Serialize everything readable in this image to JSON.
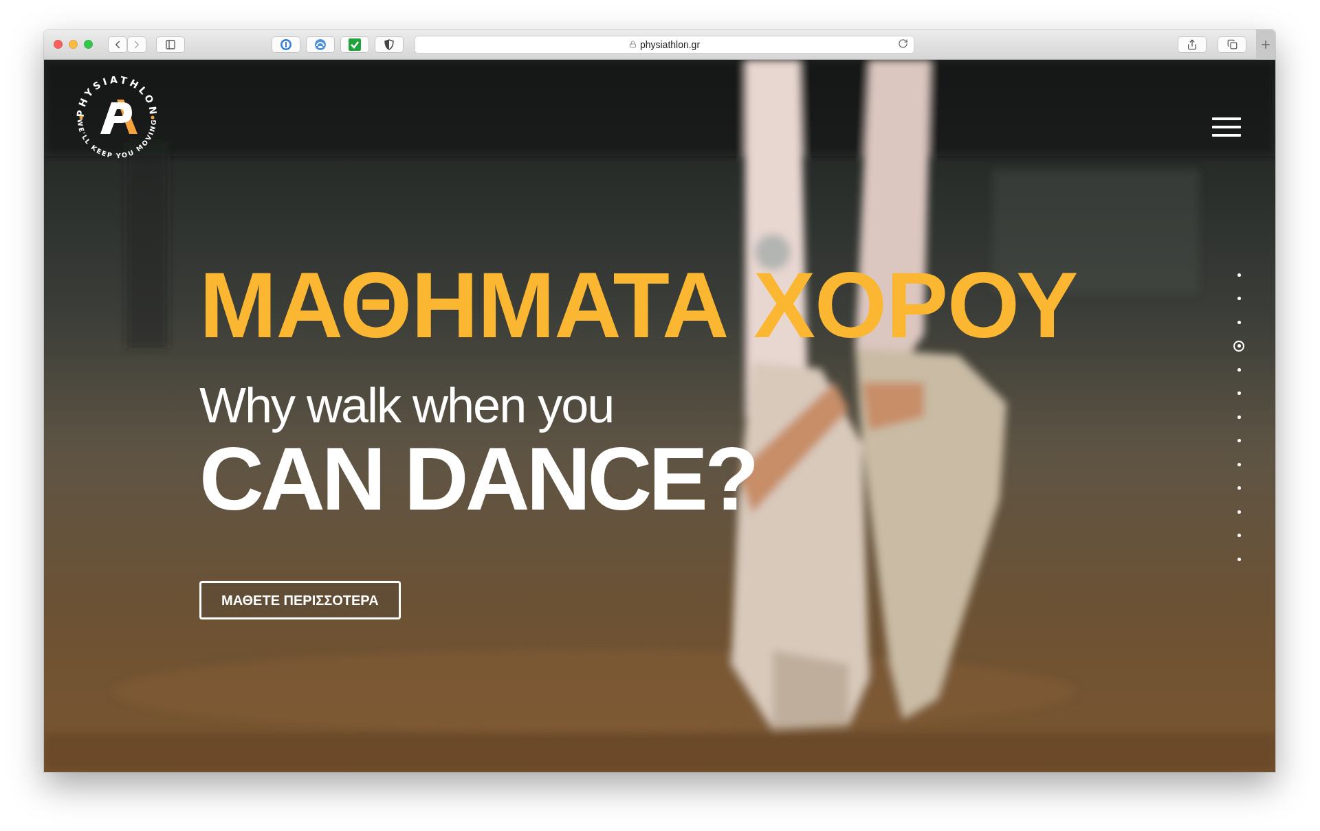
{
  "browser": {
    "url": "physiathlon.gr"
  },
  "logo": {
    "top_text": "PHYSIATHLON",
    "bottom_text": "WE'LL KEEP YOU MOVING"
  },
  "hero": {
    "title": "ΜΑΘΗΜΑΤΑ ΧΟΡΟΥ",
    "subtitle": "Why walk when you",
    "headline": "CAN DANCE?",
    "button": "ΜΑΘΕΤΕ ΠΕΡΙΣΣΟΤΕΡΑ"
  },
  "slide_dots": [
    {
      "selected": false
    },
    {
      "selected": false
    },
    {
      "selected": false
    },
    {
      "selected": true
    },
    {
      "selected": false
    },
    {
      "selected": false
    },
    {
      "selected": false
    },
    {
      "selected": false
    },
    {
      "selected": false
    },
    {
      "selected": false
    },
    {
      "selected": false
    },
    {
      "selected": false
    },
    {
      "selected": false
    }
  ]
}
